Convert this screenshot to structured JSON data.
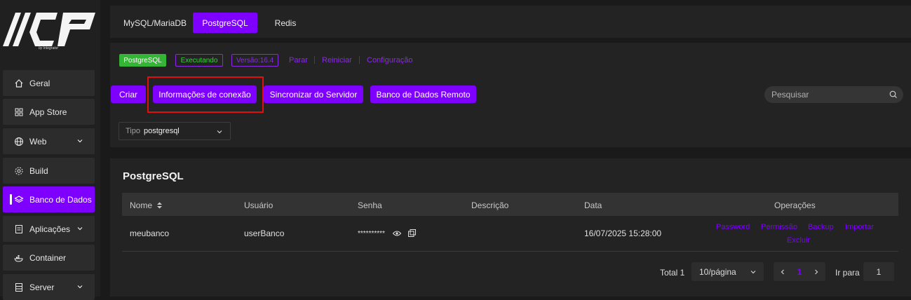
{
  "sidebar": {
    "logo_sub": "by Integrator",
    "items": [
      {
        "label": "Geral",
        "icon": "home-icon"
      },
      {
        "label": "App Store",
        "icon": "grid-icon"
      },
      {
        "label": "Web",
        "icon": "globe-icon"
      },
      {
        "label": "Build",
        "icon": "gear-icon"
      },
      {
        "label": "Banco de Dados",
        "icon": "layers-icon"
      },
      {
        "label": "Aplicações",
        "icon": "document-icon"
      },
      {
        "label": "Container",
        "icon": "docker-icon"
      },
      {
        "label": "Server",
        "icon": "server-icon"
      }
    ]
  },
  "tabs": [
    {
      "label": "MySQL/MariaDB"
    },
    {
      "label": "PostgreSQL"
    },
    {
      "label": "Redis"
    }
  ],
  "status": {
    "service": "PostgreSQL",
    "state": "Executando",
    "version": "Versão:16.4",
    "actions": [
      "Parar",
      "Reiniciar",
      "Configuração"
    ]
  },
  "toolbar": {
    "criar": "Criar",
    "info": "Informações de conexão",
    "sync": "Sincronizar do Servidor",
    "remote": "Banco de Dados Remoto",
    "search_placeholder": "Pesquisar"
  },
  "filter": {
    "label": "Tipo",
    "value": "postgresql"
  },
  "table": {
    "title": "PostgreSQL",
    "headers": {
      "nome": "Nome",
      "usuario": "Usuário",
      "senha": "Senha",
      "descricao": "Descrição",
      "data": "Data",
      "operacoes": "Operações"
    },
    "rows": [
      {
        "nome": "meubanco",
        "usuario": "userBanco",
        "senha": "**********",
        "descricao": "",
        "data": "16/07/2025 15:28:00"
      }
    ],
    "operations": [
      "Password",
      "Permissão",
      "Backup",
      "Importar",
      "Excluir"
    ]
  },
  "pagination": {
    "total": "Total 1",
    "page_size": "10/página",
    "current": "1",
    "goto_label": "Ir para",
    "goto_value": "1"
  },
  "colors": {
    "accent": "#7e00ff",
    "running": "#35b535",
    "highlight": "#e01010"
  }
}
